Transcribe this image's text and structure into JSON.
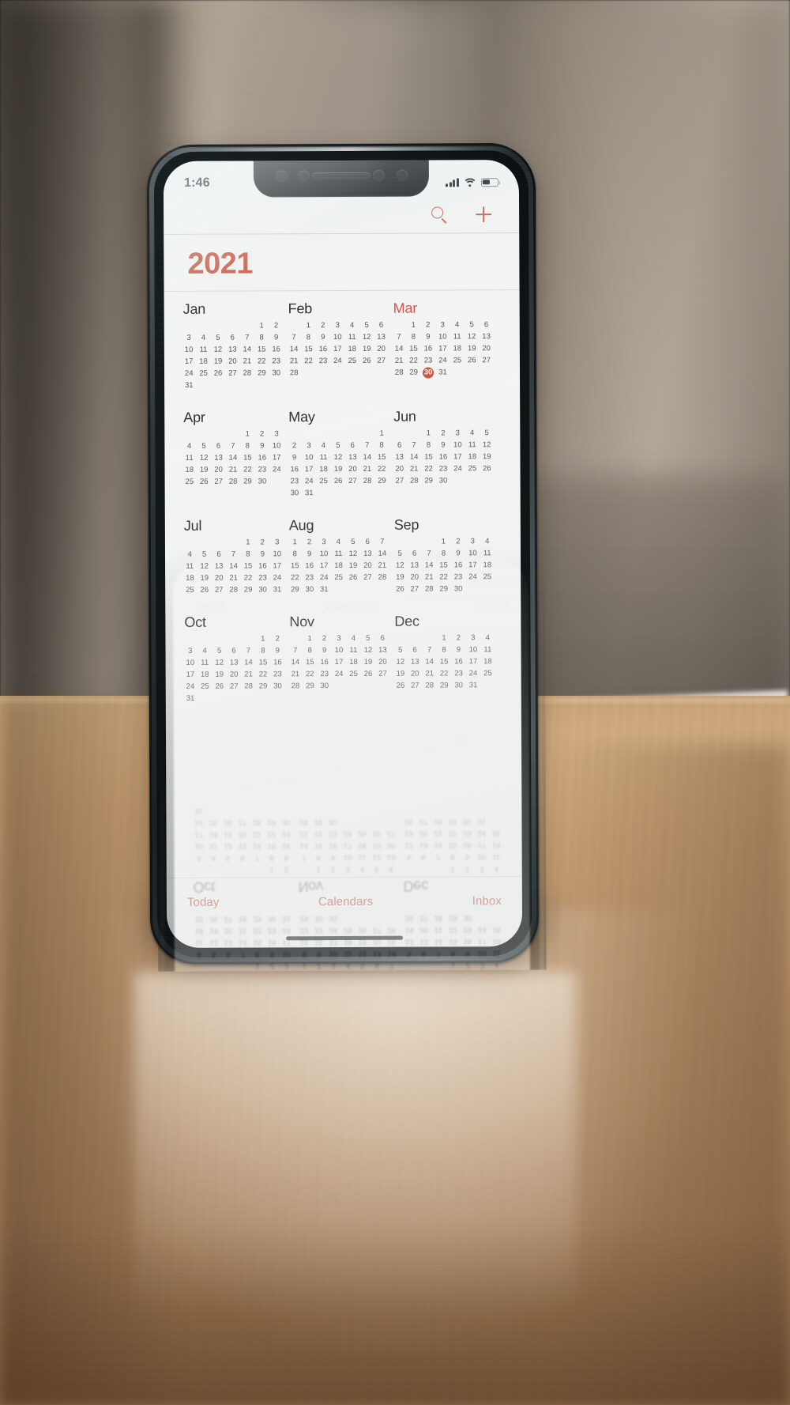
{
  "app": {
    "name": "Calendar",
    "view": "year"
  },
  "status_bar": {
    "time": "1:46",
    "cellular_icon": "cellular-signal-icon",
    "wifi_icon": "wifi-icon",
    "battery_icon": "battery-icon"
  },
  "nav_bar": {
    "search_icon": "search-icon",
    "add_icon": "plus-icon"
  },
  "header": {
    "year": "2021"
  },
  "theme": {
    "accent": "#c9563f",
    "today_badge": "#d34a3c",
    "current_month": "#d0564a",
    "day_text": "#4a5257",
    "month_text": "#23282b",
    "screen_bg": "#f4f6f5"
  },
  "today": {
    "month": "Mar",
    "day": "30"
  },
  "toolbar": {
    "today_label": "Today",
    "calendars_label": "Calendars",
    "inbox_label": "Inbox"
  },
  "months": [
    {
      "name": "Jan",
      "current": false,
      "lead_blanks": 5,
      "days": [
        "1",
        "2",
        "3",
        "4",
        "5",
        "6",
        "7",
        "8",
        "9",
        "10",
        "11",
        "12",
        "13",
        "14",
        "15",
        "16",
        "17",
        "18",
        "19",
        "20",
        "21",
        "22",
        "23",
        "24",
        "25",
        "26",
        "27",
        "28",
        "29",
        "30",
        "31"
      ]
    },
    {
      "name": "Feb",
      "current": false,
      "lead_blanks": 1,
      "days": [
        "1",
        "2",
        "3",
        "4",
        "5",
        "6",
        "7",
        "8",
        "9",
        "10",
        "11",
        "12",
        "13",
        "14",
        "15",
        "16",
        "17",
        "18",
        "19",
        "20",
        "21",
        "22",
        "23",
        "24",
        "25",
        "26",
        "27",
        "28"
      ]
    },
    {
      "name": "Mar",
      "current": true,
      "lead_blanks": 1,
      "days": [
        "1",
        "2",
        "3",
        "4",
        "5",
        "6",
        "7",
        "8",
        "9",
        "10",
        "11",
        "12",
        "13",
        "14",
        "15",
        "16",
        "17",
        "18",
        "19",
        "20",
        "21",
        "22",
        "23",
        "24",
        "25",
        "26",
        "27",
        "28",
        "29",
        "30",
        "31"
      ]
    },
    {
      "name": "Apr",
      "current": false,
      "lead_blanks": 4,
      "days": [
        "1",
        "2",
        "3",
        "4",
        "5",
        "6",
        "7",
        "8",
        "9",
        "10",
        "11",
        "12",
        "13",
        "14",
        "15",
        "16",
        "17",
        "18",
        "19",
        "20",
        "21",
        "22",
        "23",
        "24",
        "25",
        "26",
        "27",
        "28",
        "29",
        "30"
      ]
    },
    {
      "name": "May",
      "current": false,
      "lead_blanks": 6,
      "days": [
        "1",
        "2",
        "3",
        "4",
        "5",
        "6",
        "7",
        "8",
        "9",
        "10",
        "11",
        "12",
        "13",
        "14",
        "15",
        "16",
        "17",
        "18",
        "19",
        "20",
        "21",
        "22",
        "23",
        "24",
        "25",
        "26",
        "27",
        "28",
        "29",
        "30",
        "31"
      ]
    },
    {
      "name": "Jun",
      "current": false,
      "lead_blanks": 2,
      "days": [
        "1",
        "2",
        "3",
        "4",
        "5",
        "6",
        "7",
        "8",
        "9",
        "10",
        "11",
        "12",
        "13",
        "14",
        "15",
        "16",
        "17",
        "18",
        "19",
        "20",
        "21",
        "22",
        "23",
        "24",
        "25",
        "26",
        "27",
        "28",
        "29",
        "30"
      ]
    },
    {
      "name": "Jul",
      "current": false,
      "lead_blanks": 4,
      "days": [
        "1",
        "2",
        "3",
        "4",
        "5",
        "6",
        "7",
        "8",
        "9",
        "10",
        "11",
        "12",
        "13",
        "14",
        "15",
        "16",
        "17",
        "18",
        "19",
        "20",
        "21",
        "22",
        "23",
        "24",
        "25",
        "26",
        "27",
        "28",
        "29",
        "30",
        "31"
      ]
    },
    {
      "name": "Aug",
      "current": false,
      "lead_blanks": 0,
      "days": [
        "1",
        "2",
        "3",
        "4",
        "5",
        "6",
        "7",
        "8",
        "9",
        "10",
        "11",
        "12",
        "13",
        "14",
        "15",
        "16",
        "17",
        "18",
        "19",
        "20",
        "21",
        "22",
        "23",
        "24",
        "25",
        "26",
        "27",
        "28",
        "29",
        "30",
        "31"
      ]
    },
    {
      "name": "Sep",
      "current": false,
      "lead_blanks": 3,
      "days": [
        "1",
        "2",
        "3",
        "4",
        "5",
        "6",
        "7",
        "8",
        "9",
        "10",
        "11",
        "12",
        "13",
        "14",
        "15",
        "16",
        "17",
        "18",
        "19",
        "20",
        "21",
        "22",
        "23",
        "24",
        "25",
        "26",
        "27",
        "28",
        "29",
        "30"
      ]
    },
    {
      "name": "Oct",
      "current": false,
      "lead_blanks": 5,
      "days": [
        "1",
        "2",
        "3",
        "4",
        "5",
        "6",
        "7",
        "8",
        "9",
        "10",
        "11",
        "12",
        "13",
        "14",
        "15",
        "16",
        "17",
        "18",
        "19",
        "20",
        "21",
        "22",
        "23",
        "24",
        "25",
        "26",
        "27",
        "28",
        "29",
        "30",
        "31"
      ]
    },
    {
      "name": "Nov",
      "current": false,
      "lead_blanks": 1,
      "days": [
        "1",
        "2",
        "3",
        "4",
        "5",
        "6",
        "7",
        "8",
        "9",
        "10",
        "11",
        "12",
        "13",
        "14",
        "15",
        "16",
        "17",
        "18",
        "19",
        "20",
        "21",
        "22",
        "23",
        "24",
        "25",
        "26",
        "27",
        "28",
        "29",
        "30"
      ]
    },
    {
      "name": "Dec",
      "current": false,
      "lead_blanks": 3,
      "days": [
        "1",
        "2",
        "3",
        "4",
        "5",
        "6",
        "7",
        "8",
        "9",
        "10",
        "11",
        "12",
        "13",
        "14",
        "15",
        "16",
        "17",
        "18",
        "19",
        "20",
        "21",
        "22",
        "23",
        "24",
        "25",
        "26",
        "27",
        "28",
        "29",
        "30",
        "31"
      ]
    }
  ]
}
